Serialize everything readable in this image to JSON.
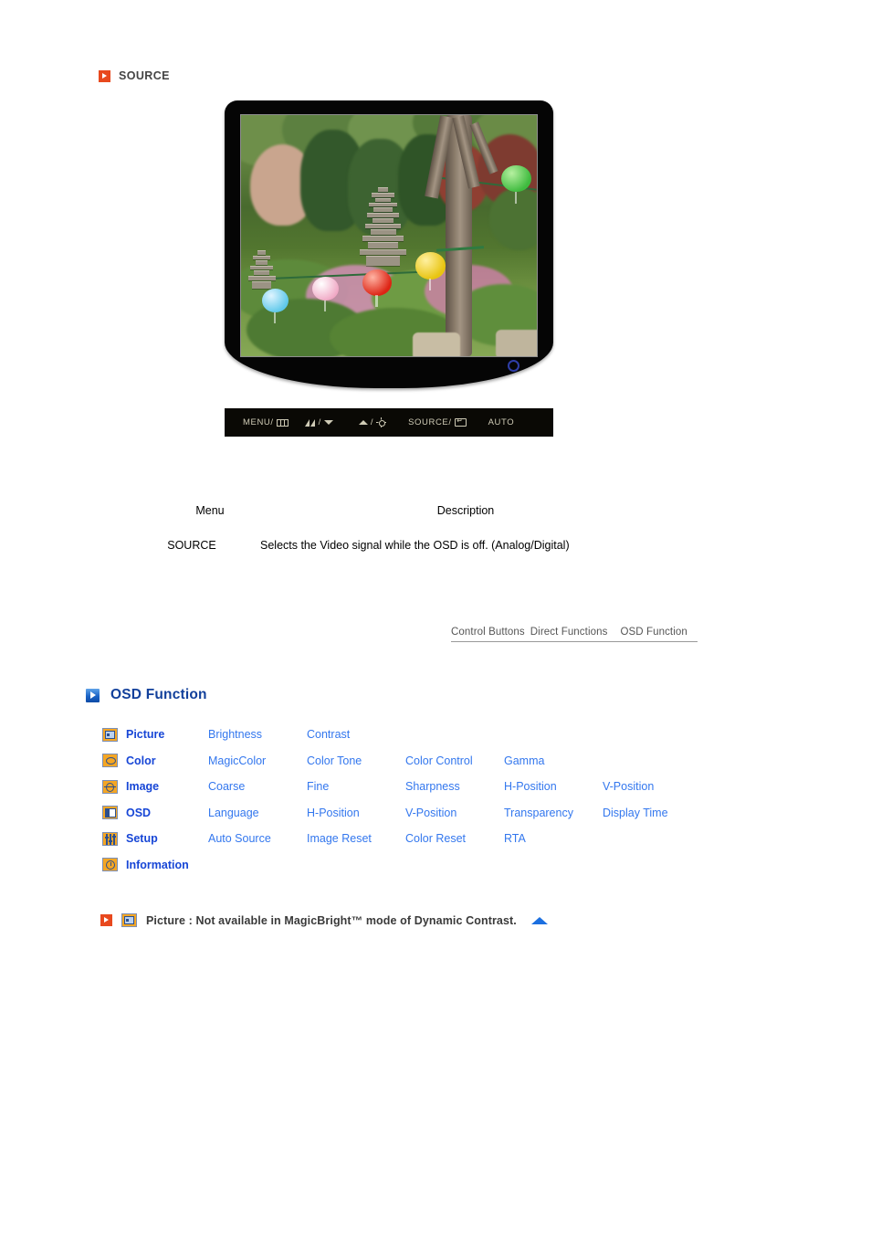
{
  "source_section": {
    "heading": "SOURCE",
    "bullet_icon": "orange-play-bullet-icon",
    "bullet_color": "#E8491E"
  },
  "monitor": {
    "screen_content_alt": "garden-photo-with-pagoda-and-paper-lanterns",
    "power_led_color": "#2f3ea8",
    "control_buttons": [
      {
        "label": "MENU/",
        "icon": "menu-bars-icon"
      },
      {
        "label": "/",
        "icon_left": "magicbright-icon",
        "icon_right": "down-arrow-icon"
      },
      {
        "label": "/",
        "icon_left": "up-arrow-icon",
        "icon_right": "brightness-sun-icon"
      },
      {
        "label": "SOURCE/",
        "icon": "enter-key-icon"
      },
      {
        "label": "AUTO",
        "icon": ""
      }
    ]
  },
  "table": {
    "headers": {
      "menu": "Menu",
      "description": "Description"
    },
    "rows": [
      {
        "menu": "SOURCE",
        "description": "Selects the Video signal while the OSD is off. (Analog/Digital)"
      }
    ]
  },
  "tabs": [
    {
      "label": "Control Buttons",
      "active": false
    },
    {
      "label": "Direct Functions",
      "active": false
    },
    {
      "label": "OSD Function",
      "active": true
    }
  ],
  "osd_section": {
    "heading": "OSD Function",
    "bullet_icon": "blue-play-bullet-icon",
    "heading_color": "#12409b",
    "rows": [
      {
        "icon": "picture-icon",
        "name": "Picture",
        "items": [
          "Brightness",
          "Contrast"
        ]
      },
      {
        "icon": "color-palette-icon",
        "name": "Color",
        "items": [
          "MagicColor",
          "Color Tone",
          "Color Control",
          "Gamma"
        ]
      },
      {
        "icon": "image-icon",
        "name": "Image",
        "items": [
          "Coarse",
          "Fine",
          "Sharpness",
          "H-Position",
          "V-Position"
        ]
      },
      {
        "icon": "osd-window-icon",
        "name": "OSD",
        "items": [
          "Language",
          "H-Position",
          "V-Position",
          "Transparency",
          "Display Time"
        ]
      },
      {
        "icon": "setup-sliders-icon",
        "name": "Setup",
        "items": [
          "Auto Source",
          "Image Reset",
          "Color Reset",
          "RTA"
        ]
      },
      {
        "icon": "information-clock-icon",
        "name": "Information",
        "items": []
      }
    ]
  },
  "footnote": {
    "bullet_icon": "orange-play-bullet-icon",
    "menu_icon": "picture-icon",
    "text": "Picture : Not available in MagicBright™ mode of Dynamic Contrast.",
    "top_arrow_icon": "scroll-to-top-triangle-icon",
    "top_arrow_color": "#1B6FE0"
  },
  "colors": {
    "accent_orange": "#E8491E",
    "icon_orange": "#F5A623",
    "link_blue": "#3377EE",
    "menu_blue": "#1746D6",
    "heading_blue": "#12409b"
  }
}
